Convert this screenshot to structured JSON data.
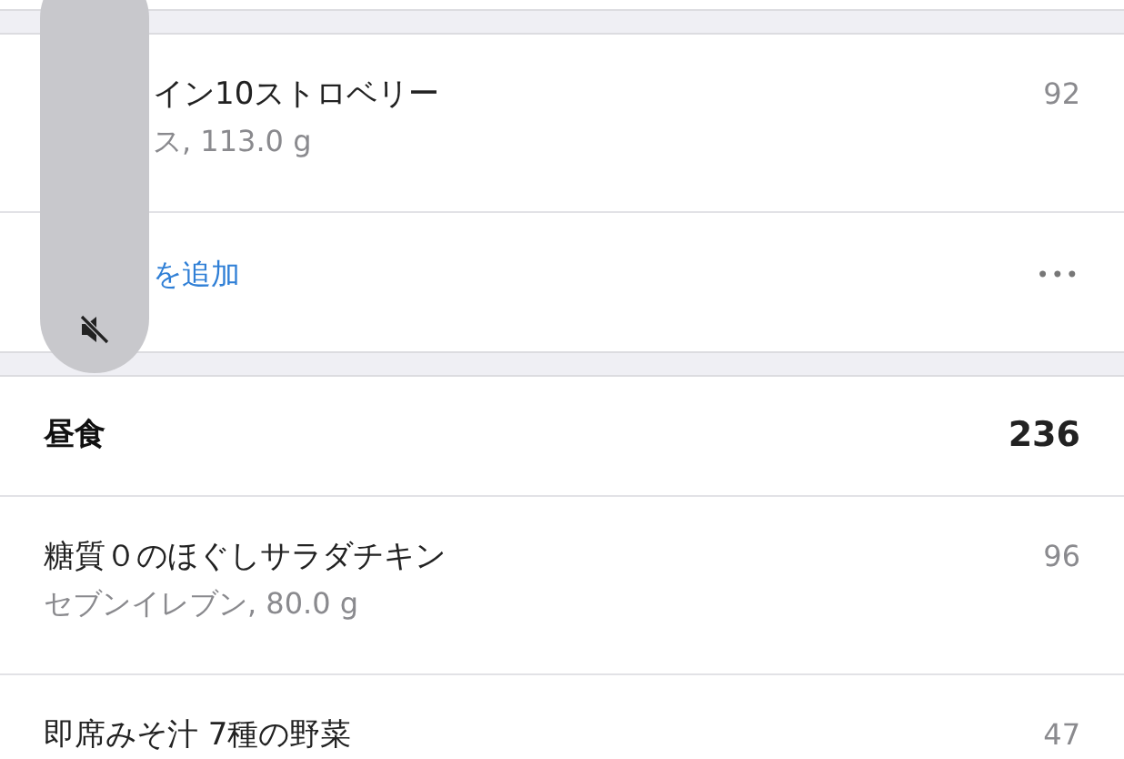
{
  "volume_hud": {
    "muted": true
  },
  "sections": [
    {
      "kind": "partial",
      "entries": [
        {
          "name": "イン10ストロベリー",
          "detail": "ス, 113.0 g",
          "calories": "92"
        }
      ],
      "add_link": "を追加",
      "more": "•••"
    },
    {
      "kind": "meal",
      "title": "昼食",
      "total": "236",
      "entries": [
        {
          "name": "糖質０のほぐしサラダチキン",
          "detail": "セブンイレブン, 80.0 g",
          "calories": "96"
        },
        {
          "name": "即席みそ汁 7種の野菜",
          "calories": "47"
        }
      ]
    }
  ]
}
